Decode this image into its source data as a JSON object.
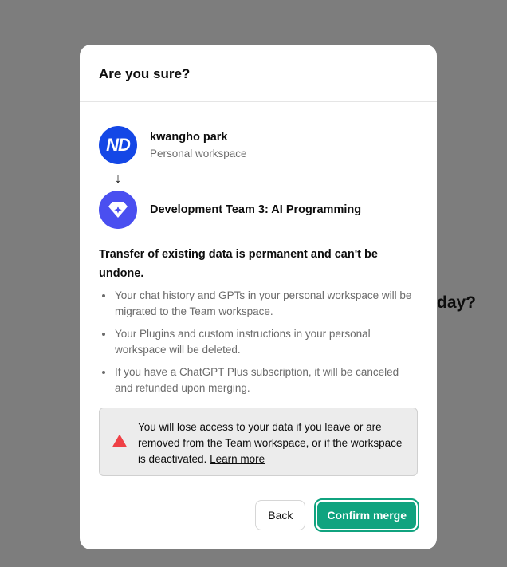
{
  "background": {
    "partial_text": "day?"
  },
  "modal": {
    "title": "Are you sure?",
    "source_workspace": {
      "avatar_initials": "ND",
      "name": "kwangho park",
      "subtitle": "Personal workspace",
      "avatar_color": "#1447e6"
    },
    "arrow": "↓",
    "target_workspace": {
      "name": "Development Team 3: AI Programming",
      "avatar_icon": "diamond-sparkle-icon",
      "avatar_color": "#4a4ff0"
    },
    "warning_heading": "Transfer of existing data is permanent and can't be undone.",
    "bullets": [
      "Your chat history and GPTs in your personal workspace will be migrated to the Team workspace.",
      "Your Plugins and custom instructions in your personal workspace will be deleted.",
      "If you have a ChatGPT Plus subscription, it will be canceled and refunded upon merging."
    ],
    "alert": {
      "icon": "warning-triangle-icon",
      "text": "You will lose access to your data if you leave or are removed from the Team workspace, or if the workspace is deactivated.",
      "link": "Learn more",
      "icon_color": "#ef4146"
    },
    "buttons": {
      "back": "Back",
      "confirm": "Confirm merge",
      "confirm_color": "#10a37f"
    }
  }
}
